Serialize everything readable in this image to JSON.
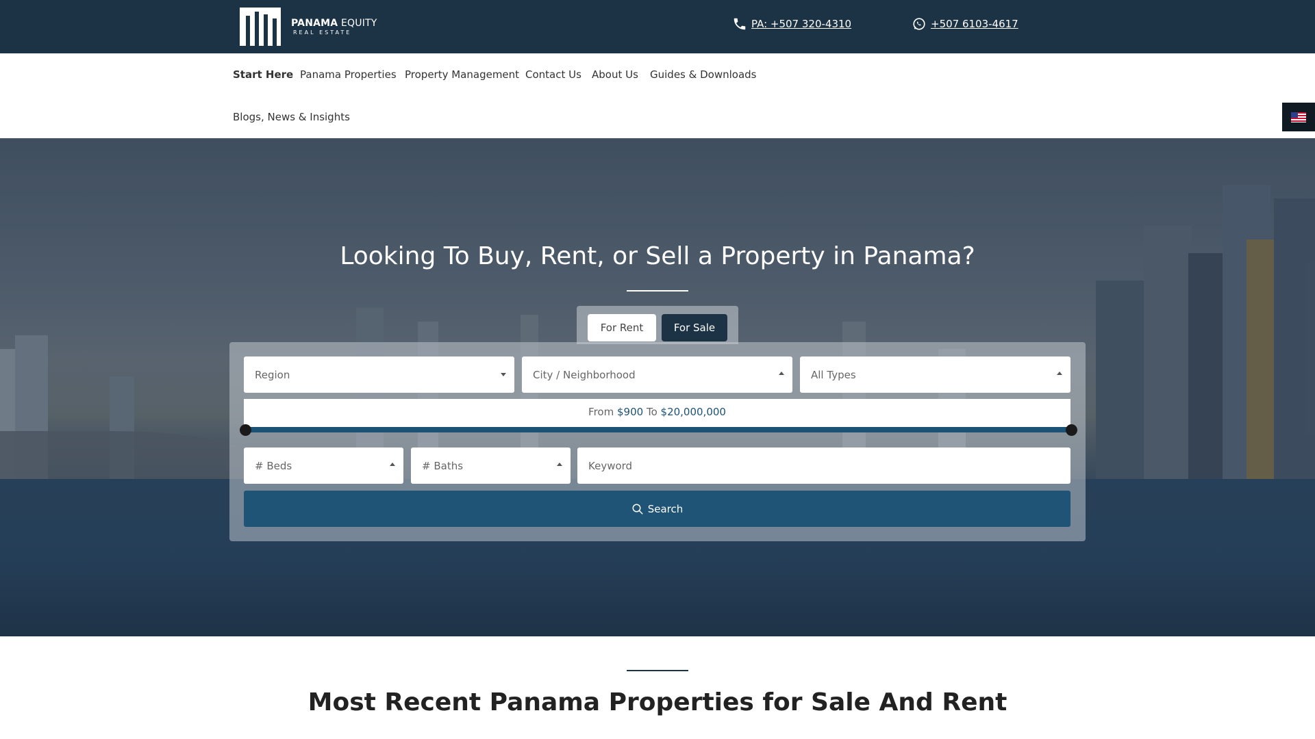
{
  "header": {
    "logo": {
      "name_bold": "PANAMA",
      "name_rest": "EQUITY",
      "sub": "REAL ESTATE"
    },
    "phone_pa": {
      "icon": "phone-icon",
      "text": "PA: +507 320-4310"
    },
    "phone_wa": {
      "icon": "whatsapp-icon",
      "text": "+507 6103-4617"
    },
    "colors": {
      "bar": "#1c3345"
    }
  },
  "nav": {
    "items": [
      {
        "label": "Start Here"
      },
      {
        "label": "Panama Properties"
      },
      {
        "label": "Property Management"
      },
      {
        "label": "Contact Us"
      },
      {
        "label": "About Us"
      },
      {
        "label": "Guides & Downloads"
      },
      {
        "label": "Blogs, News & Insights"
      }
    ],
    "language_flag": "us-flag-icon"
  },
  "hero": {
    "title": "Looking To Buy, Rent, or Sell a Property in Panama?",
    "tabs": [
      {
        "label": "For Rent",
        "active": false
      },
      {
        "label": "For Sale",
        "active": true
      }
    ],
    "filters": {
      "region": "Region",
      "city": "City / Neighborhood",
      "type": "All Types",
      "beds": "# Beds",
      "baths": "# Baths",
      "keyword_placeholder": "Keyword"
    },
    "price": {
      "from_label": "From",
      "from_value": "$900",
      "to_label": "To",
      "to_value": "$20,000,000",
      "range_min": 900,
      "range_max": 20000000
    },
    "search_label": "Search"
  },
  "section": {
    "title": "Most Recent Panama Properties for Sale And Rent"
  }
}
